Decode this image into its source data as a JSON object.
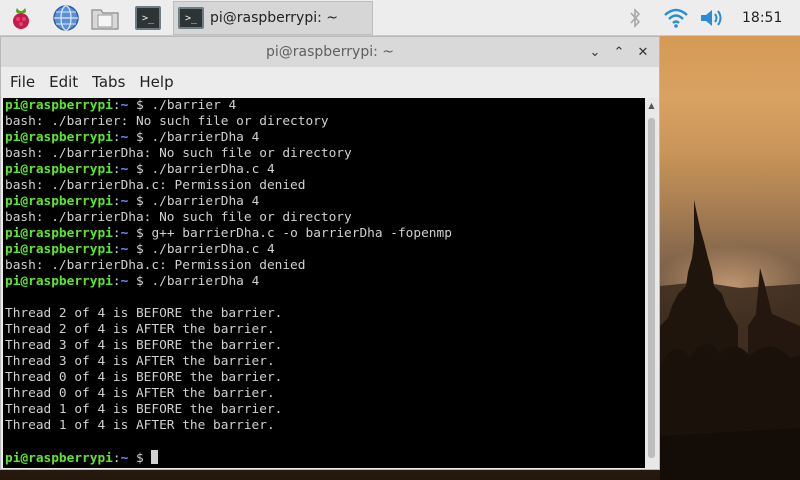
{
  "panel": {
    "taskbar_title": "pi@raspberrypi: ~",
    "clock": "18:51",
    "icons": [
      "raspberry-menu-icon",
      "web-browser-icon",
      "file-manager-icon",
      "terminal-launcher-icon",
      "bluetooth-icon",
      "wifi-icon",
      "volume-icon"
    ],
    "terminal_glyph": ">_"
  },
  "window": {
    "title": "pi@raspberrypi: ~",
    "controls": {
      "minimize": "⌄",
      "maximize": "⌃",
      "close": "✕"
    },
    "menu": [
      "File",
      "Edit",
      "Tabs",
      "Help"
    ]
  },
  "prompt": {
    "user": "pi@raspberrypi",
    "sep": ":",
    "path": "~",
    "sym": " $ "
  },
  "terminal_lines": [
    {
      "type": "prompt",
      "cmd": "./barrier 4"
    },
    {
      "type": "out",
      "text": "bash: ./barrier: No such file or directory"
    },
    {
      "type": "prompt",
      "cmd": "./barrierDha 4"
    },
    {
      "type": "out",
      "text": "bash: ./barrierDha: No such file or directory"
    },
    {
      "type": "prompt",
      "cmd": "./barrierDha.c 4"
    },
    {
      "type": "out",
      "text": "bash: ./barrierDha.c: Permission denied"
    },
    {
      "type": "prompt",
      "cmd": "./barrierDha 4"
    },
    {
      "type": "out",
      "text": "bash: ./barrierDha: No such file or directory"
    },
    {
      "type": "prompt",
      "cmd": "g++ barrierDha.c -o barrierDha -fopenmp"
    },
    {
      "type": "prompt",
      "cmd": "./barrierDha.c 4"
    },
    {
      "type": "out",
      "text": "bash: ./barrierDha.c: Permission denied"
    },
    {
      "type": "prompt",
      "cmd": "./barrierDha 4"
    },
    {
      "type": "out",
      "text": ""
    },
    {
      "type": "out",
      "text": "Thread 2 of 4 is BEFORE the barrier."
    },
    {
      "type": "out",
      "text": "Thread 2 of 4 is AFTER the barrier."
    },
    {
      "type": "out",
      "text": "Thread 3 of 4 is BEFORE the barrier."
    },
    {
      "type": "out",
      "text": "Thread 3 of 4 is AFTER the barrier."
    },
    {
      "type": "out",
      "text": "Thread 0 of 4 is BEFORE the barrier."
    },
    {
      "type": "out",
      "text": "Thread 0 of 4 is AFTER the barrier."
    },
    {
      "type": "out",
      "text": "Thread 1 of 4 is BEFORE the barrier."
    },
    {
      "type": "out",
      "text": "Thread 1 of 4 is AFTER the barrier."
    },
    {
      "type": "out",
      "text": ""
    },
    {
      "type": "prompt",
      "cmd": "",
      "cursor": true
    }
  ],
  "colors": {
    "prompt_user": "#5ee52e",
    "prompt_path": "#6f8dff",
    "terminal_bg": "#000000",
    "terminal_fg": "#d0d0d0",
    "wifi_blue": "#2a8cd6"
  }
}
